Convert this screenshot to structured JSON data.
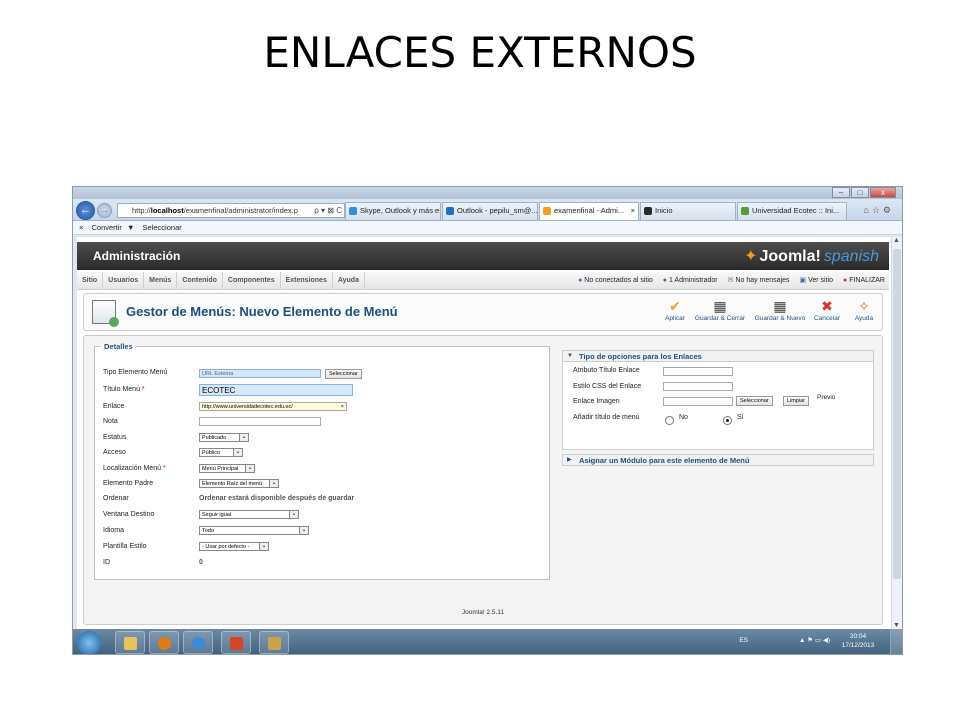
{
  "slide": {
    "title": "ENLACES EXTERNOS"
  },
  "browser": {
    "address": "http://localhost/examenfinal/administrator/index.p",
    "address_host": "localhost",
    "address_prefix": "http://",
    "address_rest": "/examenfinal/administrator/index.p",
    "address_tools": "ρ ▾ ⊠ C",
    "tabs": [
      {
        "label": "Skype, Outlook y más e...",
        "icon_color": "#2f8fd8"
      },
      {
        "label": "Outlook - pepilu_sm@...",
        "icon_color": "#1f6fc0"
      },
      {
        "label": "examenfinal - Admi...",
        "icon_color": "#f29f1f",
        "close": "×"
      },
      {
        "label": "Inicio",
        "icon_color": "#2a2a2a"
      },
      {
        "label": "Universidad Ecotec :: Ini...",
        "icon_color": "#5a9a3a"
      }
    ],
    "command_bar": {
      "close": "×",
      "convert": "Convertir",
      "convert_arrow": "▼",
      "select": "Seleccionar"
    },
    "window_buttons": [
      "–",
      "□",
      "x"
    ]
  },
  "joomla": {
    "header_title": "Administración",
    "logo_text": "Joomla!",
    "logo_suffix": "spanish",
    "menu": [
      "Sitio",
      "Usuarios",
      "Menús",
      "Contenido",
      "Componentes",
      "Extensiones",
      "Ayuda"
    ],
    "status": {
      "not_connected": "No conectados al sitio",
      "admins": "1 Administrador",
      "messages": "No hay mensajes",
      "view_site": "Ver sitio",
      "logout": "FINALIZAR"
    },
    "page_heading": "Gestor de Menús: Nuevo Elemento de Menú",
    "toolbar": {
      "apply": "Aplicar",
      "save_close": "Guardar & Cerrar",
      "save_new": "Guardar & Nuevo",
      "cancel": "Cancelar",
      "help": "Ayuda"
    },
    "details": {
      "legend": "Detalles",
      "type_label": "Tipo Elemento Menú",
      "type_value": "URL Externa",
      "select_button": "Seleccionar",
      "title_label": "Título Menú",
      "title_value": "ECOTEC",
      "link_label": "Enlace",
      "link_value": "http://www.universidadecotec.edu.ec/",
      "link_clear": "×",
      "note_label": "Nota",
      "note_value": "",
      "status_label": "Estatus",
      "status_value": "Publicado",
      "access_label": "Acceso",
      "access_value": "Público",
      "menu_location_label": "Localización Menú",
      "menu_location_value": "Menú Principal",
      "parent_label": "Elemento Padre",
      "parent_value": "Elemento Raíz del menú",
      "order_label": "Ordenar",
      "order_note": "Ordenar estará disponible después de guardar",
      "target_label": "Ventana Destino",
      "target_value": "Seguir igual",
      "language_label": "Idioma",
      "language_value": "Todo",
      "template_label": "Plantilla Estilo",
      "template_value": "- Usar por defecto -",
      "id_label": "ID",
      "id_value": "0",
      "required_mark": "*",
      "dropdown_arrow": "⌄"
    },
    "link_options": {
      "heading": "Tipo de opciones para los Enlaces",
      "title_attr_label": "Atributo Título Enlace",
      "css_label": "Estilo CSS del Enlace",
      "image_label": "Enlace Imagen",
      "select_button": "Seleccionar",
      "clear_button": "Limpiar",
      "preview": "Previo",
      "add_title_label": "Añadir título de menú",
      "no": "No",
      "yes": "Sí",
      "selected": "yes"
    },
    "module_heading": "Asignar un Módulo para este elemento de Menú",
    "footer": "Joomla! 2.5.11"
  },
  "taskbar": {
    "language": "ES",
    "tray_icons": "▲ ⚑ ▭ ◀)",
    "time": "20:04",
    "date": "17/12/2013",
    "apps": [
      {
        "name": "file-explorer",
        "color": "#e8c25a"
      },
      {
        "name": "media-player",
        "color": "#e07a1f"
      },
      {
        "name": "internet-explorer",
        "color": "#3c8ad8"
      },
      {
        "name": "powerpoint",
        "color": "#d24726"
      },
      {
        "name": "archive",
        "color": "#c9a24a"
      }
    ]
  },
  "colors": {
    "accent": "#1d4f7f",
    "header": "#2a2a2a",
    "joomla_orange": "#f29f1f"
  }
}
